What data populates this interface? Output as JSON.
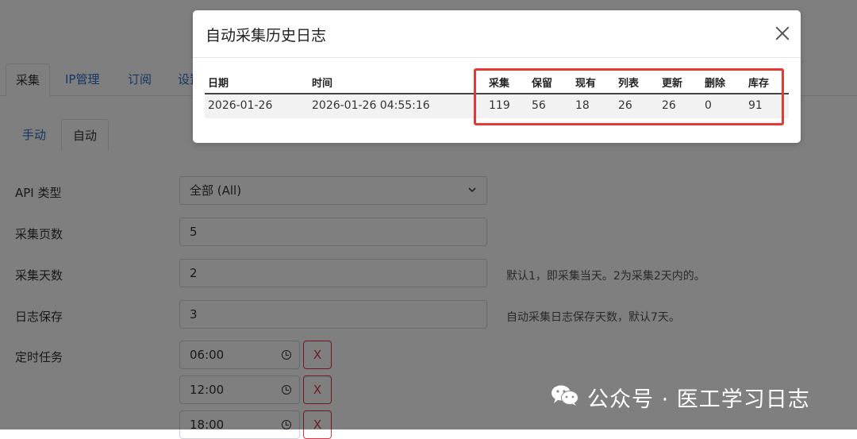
{
  "main_tabs": [
    {
      "label": "采集",
      "active": true
    },
    {
      "label": "IP管理",
      "active": false
    },
    {
      "label": "订阅",
      "active": false
    },
    {
      "label": "设置",
      "active": false
    }
  ],
  "sub_tabs": [
    {
      "label": "手动",
      "active": false
    },
    {
      "label": "自动",
      "active": true
    }
  ],
  "form": {
    "api_type": {
      "label": "API 类型",
      "value": "全部 (All)"
    },
    "pages": {
      "label": "采集页数",
      "value": "5"
    },
    "days": {
      "label": "采集天数",
      "value": "2",
      "hint": "默认1，即采集当天。2为采集2天内的。"
    },
    "log_keep": {
      "label": "日志保存",
      "value": "3",
      "hint": "自动采集日志保存天数，默认7天。"
    },
    "schedule": {
      "label": "定时任务",
      "times": [
        "06:00",
        "12:00",
        "18:00"
      ],
      "delete_label": "X"
    }
  },
  "modal": {
    "title": "自动采集历史日志",
    "table": {
      "headers": [
        "日期",
        "时间",
        "采集",
        "保留",
        "现有",
        "列表",
        "更新",
        "删除",
        "库存"
      ],
      "rows": [
        [
          "2026-01-26",
          "2026-01-26 04:55:16",
          "119",
          "56",
          "18",
          "26",
          "26",
          "0",
          "91"
        ]
      ]
    }
  },
  "watermark": {
    "text": "公众号 · 医工学习日志"
  },
  "colors": {
    "highlight": "#e53935",
    "link": "#2a6fc4",
    "danger": "#dc3545"
  }
}
